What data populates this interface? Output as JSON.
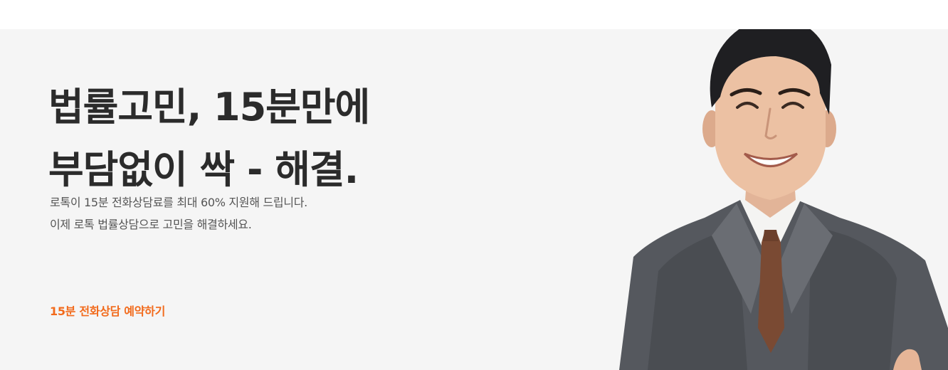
{
  "hero": {
    "headline_line1": "법률고민, 15분만에",
    "headline_line2": "부담없이 싹 - 해결.",
    "sub_line1": "로톡이 15분 전화상담료를 최대 60% 지원해 드립니다.",
    "sub_line2": "이제 로톡 법률상담으로 고민을 해결하세요.",
    "cta_label": "15분 전화상담 예약하기"
  },
  "colors": {
    "background": "#f5f5f5",
    "headline": "#2b2b2b",
    "body_text": "#555555",
    "accent": "#f26a1b"
  },
  "icons": {
    "portrait": "smiling-man-in-gray-suit"
  }
}
